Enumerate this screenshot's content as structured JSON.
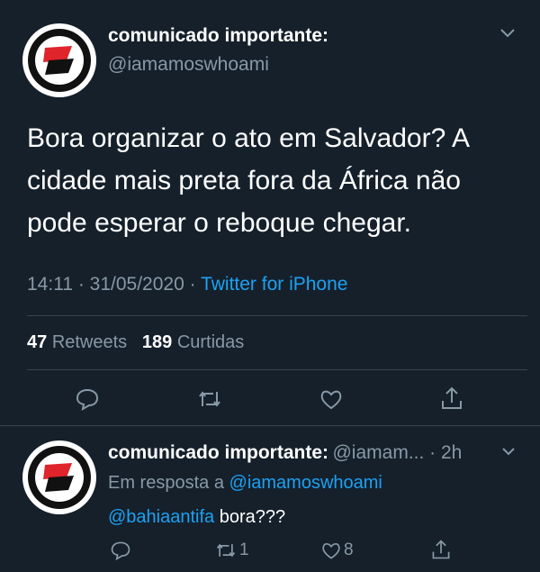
{
  "main_tweet": {
    "display_name": "comunicado importante:",
    "handle": "@iamamoswhoami",
    "text": "Bora organizar o ato em Salvador? A cidade mais preta fora da África não pode esperar o reboque chegar.",
    "time": "14:11 · 31/05/2020 ·",
    "source": "Twitter for iPhone",
    "retweets_count": "47",
    "retweets_label": "Retweets",
    "likes_count": "189",
    "likes_label": "Curtidas"
  },
  "reply": {
    "display_name": "comunicado importante:",
    "handle_time": "@iamam... · 2h",
    "in_reply_prefix": "Em resposta a",
    "in_reply_handle": "@iamamoswhoami",
    "mention": "@bahiaantifa",
    "text": " bora???",
    "retweet_count": "1",
    "like_count": "8"
  },
  "colors": {
    "background": "#15202b",
    "accent": "#1da1f2",
    "muted": "#8899a6",
    "divider": "#38444d",
    "flag_red": "#e0242b"
  },
  "icons": [
    "chevron-down-icon",
    "reply-icon",
    "retweet-icon",
    "like-icon",
    "share-icon",
    "antifa-flag-icon"
  ]
}
